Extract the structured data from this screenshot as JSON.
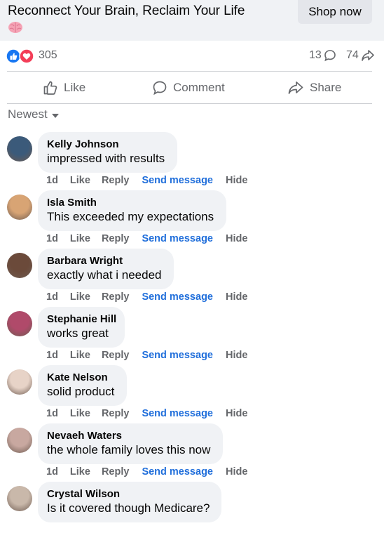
{
  "ad": {
    "title": "Reconnect Your Brain, Reclaim Your Life",
    "emoji": "brain-emoji",
    "cta": "Shop now"
  },
  "stats": {
    "reactions": "305",
    "comments": "13",
    "shares": "74"
  },
  "actions": {
    "like": "Like",
    "comment": "Comment",
    "share": "Share"
  },
  "sort": {
    "label": "Newest"
  },
  "comment_actions": {
    "like": "Like",
    "reply": "Reply",
    "send": "Send message",
    "hide": "Hide"
  },
  "comments": [
    {
      "name": "Kelly Johnson",
      "text": "impressed with results",
      "time": "1d",
      "avatar_color": "#3b5a7a"
    },
    {
      "name": "Isla Smith",
      "text": "This exceeded my expectations",
      "time": "1d",
      "avatar_color": "#d8a474"
    },
    {
      "name": "Barbara Wright",
      "text": "exactly what i needed",
      "time": "1d",
      "avatar_color": "#6b4a3a"
    },
    {
      "name": "Stephanie Hill",
      "text": "works great",
      "time": "1d",
      "avatar_color": "#b04a6a"
    },
    {
      "name": "Kate Nelson",
      "text": "solid product",
      "time": "1d",
      "avatar_color": "#e7d3c7"
    },
    {
      "name": "Nevaeh Waters",
      "text": "the whole family loves this now",
      "time": "1d",
      "avatar_color": "#c8a8a0"
    },
    {
      "name": "Crystal Wilson",
      "text": "Is it covered though Medicare?",
      "time": "",
      "avatar_color": "#c9b8aa"
    }
  ],
  "colors": {
    "link_blue": "#216fdb",
    "like_blue": "#1877f2",
    "love_red": "#f33e58",
    "bubble_bg": "#f0f2f5"
  }
}
